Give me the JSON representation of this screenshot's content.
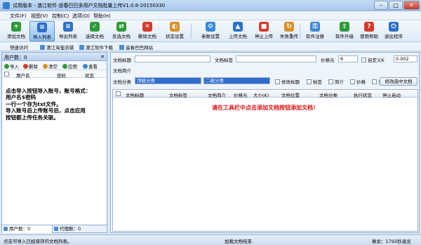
{
  "window": {
    "title": "试用版本 - 澳江软件-遥春巴巴多用户文档批量上传V1.0.8-20150330",
    "minimize": "–",
    "maximize": "□",
    "close": "✕"
  },
  "menu": [
    "文件(F)",
    "视图(V)",
    "控制(C)",
    "选项(O)",
    "帮助(H)"
  ],
  "toolbar": [
    {
      "label": "添加文档",
      "icon": "add-doc-icon",
      "glyph": "+",
      "color": "#2f9a3a"
    },
    {
      "label": "导入列表",
      "icon": "import-list-icon",
      "glyph": "≡",
      "color": "#2d6fc8"
    },
    {
      "label": "导出列表",
      "icon": "export-list-icon",
      "glyph": "≡",
      "color": "#2d6fc8"
    },
    {
      "label": "选择文档",
      "icon": "select-doc-icon",
      "glyph": "✓",
      "color": "#2f9a3a"
    },
    {
      "label": "反选文档",
      "icon": "invert-select-icon",
      "glyph": "⇄",
      "color": "#2f9a3a"
    },
    {
      "label": "删除文档",
      "icon": "delete-doc-icon",
      "glyph": "✕",
      "color": "#d23b2b"
    },
    {
      "label": "状态设置",
      "icon": "status-settings-icon",
      "glyph": "◐",
      "color": "#d9902a"
    },
    {
      "label": "参数设置",
      "icon": "settings-gear-icon",
      "glyph": "⚙",
      "color": "#3a88d8"
    },
    {
      "label": "上传文档",
      "icon": "upload-doc-icon",
      "glyph": "▲",
      "color": "#2d6fc8"
    },
    {
      "label": "停止上传",
      "icon": "stop-upload-icon",
      "glyph": "■",
      "color": "#d23b2b"
    },
    {
      "label": "失败重传",
      "icon": "retry-failed-icon",
      "glyph": "↻",
      "color": "#d9902a"
    },
    {
      "label": "软件注册",
      "icon": "register-key-icon",
      "glyph": "⚿",
      "color": "#3a88d8"
    },
    {
      "label": "软件升级",
      "icon": "upgrade-icon",
      "glyph": "⇧",
      "color": "#2f9a3a"
    },
    {
      "label": "使用帮助",
      "icon": "help-icon",
      "glyph": "?",
      "color": "#d23b2b"
    },
    {
      "label": "退出程序",
      "icon": "exit-icon",
      "glyph": "⏻",
      "color": "#2d6fc8"
    }
  ],
  "linkbar": {
    "label": "快速访问",
    "links": [
      "澳江淘宝店铺",
      "澳江软件下载",
      "遥春巴巴网站"
    ]
  },
  "left_panel": {
    "header": "用户数：0",
    "close": "✕",
    "tools": [
      {
        "label": "导入",
        "color": "#2f9a3a"
      },
      {
        "label": "删除",
        "color": "#d23b2b"
      },
      {
        "label": "清空",
        "color": "#d9902a"
      },
      {
        "label": "应用",
        "color": "#2f9a3a"
      },
      {
        "label": "查看",
        "color": "#3a88d8"
      }
    ],
    "columns": [
      "用户名",
      "密码",
      "状态"
    ],
    "message": "点击导入按钮导入账号，账号格式：\n用户名$密码\n一行一个存为txt文件。\n导入账号后上传账号后，点击应用\n按钮都上传任务关联。",
    "tabs": [
      "用户数：0",
      "代理数：0"
    ]
  },
  "form": {
    "doc_title_label": "文档标题",
    "doc_tags_label": "文档标签",
    "price_label": "价格元",
    "price_value": "6",
    "custom_k_label": "自定义K",
    "custom_k_value": "0.002",
    "summary_label": "文档简介",
    "category_label": "文档分类",
    "category_1": "顶级分类",
    "category_2": "二级分类",
    "checkboxes": [
      "修改标题",
      "标签",
      "简介",
      "价格",
      "分类"
    ],
    "modify_button": "修改选中文档"
  },
  "grid": {
    "columns": [
      "文档标题",
      "文档标签",
      "文档简介",
      "价格元",
      "大小(K)",
      "文档位置",
      "文档分类",
      "执行状态",
      "停止启动"
    ],
    "empty_message": "请在工具栏中点击添加文档按钮添加文档！"
  },
  "status": {
    "left": "点击可导入已经保存的文档列表。",
    "center": "加载文档结束",
    "right": "剩余：1792秒退出"
  }
}
